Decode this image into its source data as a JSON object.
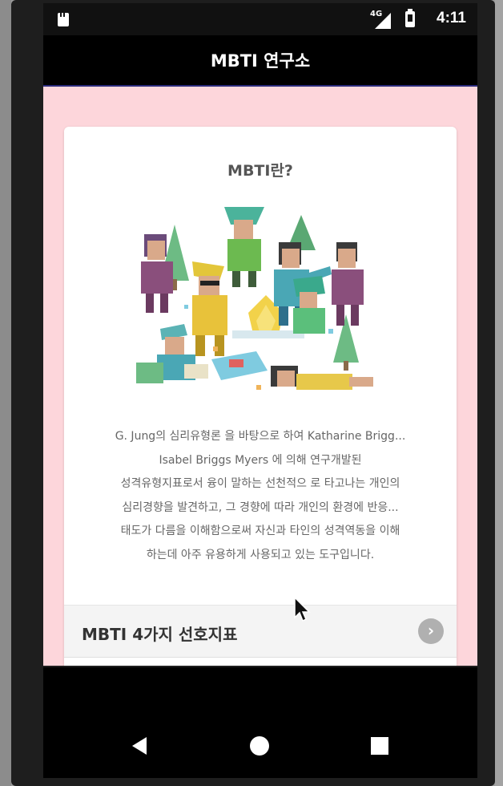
{
  "status_bar": {
    "network_type": "4G",
    "time": "4:11"
  },
  "app_bar": {
    "title": "MBTI 연구소"
  },
  "card": {
    "title": "MBTI란?",
    "description_lines": [
      "G. Jung의 심리유형론 을 바탕으로 하여 Katharine Brigg...",
      "Isabel Briggs Myers 에 의해 연구개발된",
      "성격유형지표로서 융이 말하는 선천적으 로 타고나는 개인의",
      "심리경향을 발견하고, 그 경향에 따라 개인의 환경에 반응...",
      "태도가 다름을 이해함으로써 자신과 타인의 성격역동을 이해",
      "하는데 아주 유용하게 사용되고 있는 도구입니다."
    ],
    "preference_row": {
      "label": "MBTI 4가지 선호지표",
      "icon": "chevron-right-icon"
    }
  },
  "nav_bar": {
    "back_icon": "back-icon",
    "home_icon": "home-icon",
    "recents_icon": "recents-icon"
  },
  "colors": {
    "content_background": "#fdd6db",
    "app_bar": "#000000",
    "card": "#ffffff"
  }
}
